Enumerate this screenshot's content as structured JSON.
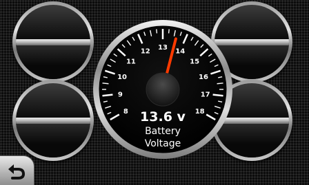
{
  "main_gauge": {
    "value_text": "13.6 v",
    "label_line1": "Battery",
    "label_line2": "Voltage",
    "tick_labels": [
      "8",
      "9",
      "10",
      "11",
      "12",
      "13",
      "14",
      "15",
      "16",
      "17",
      "18"
    ],
    "needle_value": 13.6,
    "needle_color": "#ff3a00"
  },
  "side_gauges": [
    {
      "position": "top-left"
    },
    {
      "position": "bottom-left"
    },
    {
      "position": "top-right"
    },
    {
      "position": "bottom-right"
    }
  ],
  "back_button": {
    "icon": "back-arrow-icon"
  }
}
